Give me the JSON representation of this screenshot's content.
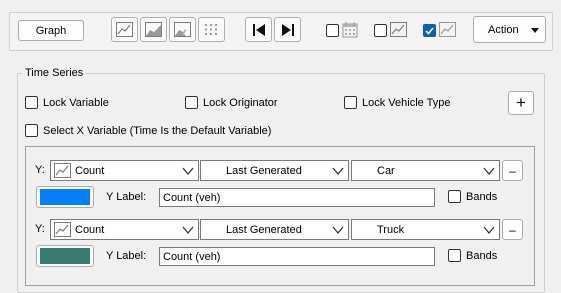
{
  "toolbar": {
    "graph_label": "Graph",
    "action_label": "Action",
    "graph_colors": {
      "line": "#6a6a6a",
      "fill": "#9a9a9a"
    },
    "checkbox3_checked": true,
    "icons": [
      "line-chart-icon",
      "area-chart-icon",
      "add-chart-icon",
      "grid-icon",
      "skip-back-icon",
      "skip-forward-icon",
      "calendar-icon",
      "line-chart-icon",
      "line-chart-icon"
    ]
  },
  "time_series": {
    "group_title": "Time Series",
    "lock_variable": "Lock Variable",
    "lock_originator": "Lock Originator",
    "lock_vehicle_type": "Lock Vehicle Type",
    "add_symbol": "+",
    "select_x_variable": "Select X Variable (Time Is the Default Variable)"
  },
  "series": [
    {
      "y_prefix": "Y:",
      "variable": "Count",
      "originator": "Last Generated",
      "vehicle_type": "Car",
      "remove_symbol": "–",
      "color": "#0080ff",
      "y_label_caption": "Y Label:",
      "y_label_value": "Count (veh)",
      "bands_label": "Bands"
    },
    {
      "y_prefix": "Y:",
      "variable": "Count",
      "originator": "Last Generated",
      "vehicle_type": "Truck",
      "remove_symbol": "–",
      "color": "#3a7b70",
      "y_label_caption": "Y Label:",
      "y_label_value": "Count (veh)",
      "bands_label": "Bands"
    }
  ]
}
